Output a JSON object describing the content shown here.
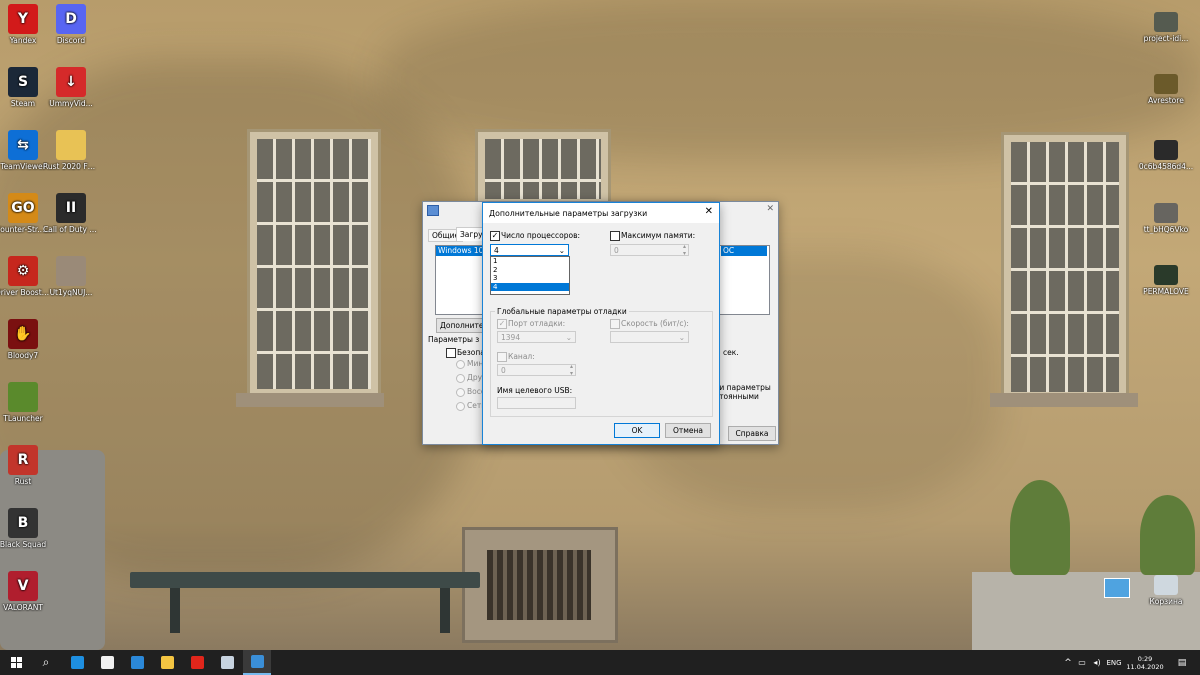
{
  "desktop": {
    "icons_left": [
      {
        "label": "Yandex",
        "color": "#d21a1a",
        "glyph": "Y"
      },
      {
        "label": "Discord",
        "color": "#5865f2",
        "glyph": "D"
      },
      {
        "label": "Steam",
        "color": "#1b2838",
        "glyph": "S"
      },
      {
        "label": "UmmyVid...",
        "color": "#d52a2a",
        "glyph": "↓"
      },
      {
        "label": "TeamViewer",
        "color": "#0e6fd6",
        "glyph": "⇆"
      },
      {
        "label": "Rust 2020 FPS Pack",
        "color": "#e8c255",
        "glyph": ""
      },
      {
        "label": "Counter-Str... Global Offe...",
        "color": "#d48a18",
        "glyph": "GO"
      },
      {
        "label": "Call of Duty Black Ops II...",
        "color": "#2b2b2b",
        "glyph": "II"
      },
      {
        "label": "Driver Booster f...",
        "color": "#c6271d",
        "glyph": "⚙"
      },
      {
        "label": "Ut1yqNUJ...",
        "color": "#9a8a78",
        "glyph": ""
      },
      {
        "label": "Bloody7",
        "color": "#7a1010",
        "glyph": "✋"
      },
      {
        "label": "TLauncher",
        "color": "#5a8a2c",
        "glyph": ""
      },
      {
        "label": "Rust",
        "color": "#c2352b",
        "glyph": "R"
      },
      {
        "label": "Black Squad",
        "color": "#333333",
        "glyph": "B"
      },
      {
        "label": "VALORANT",
        "color": "#b01e2e",
        "glyph": "V"
      }
    ],
    "icons_right": [
      {
        "label": "project-idi...",
        "color": "#555b50"
      },
      {
        "label": "Avrestore",
        "color": "#6b5a2a"
      },
      {
        "label": "0c6b4586d4...",
        "color": "#2a2a2a"
      },
      {
        "label": "tt_bHQ6Vko",
        "color": "#676560"
      },
      {
        "label": "PERMALOVE",
        "color": "#2a3a2a"
      },
      {
        "label": "Корзина",
        "color": "#cfd8df"
      }
    ]
  },
  "back_dialog": {
    "tabs": [
      "Общие",
      "Загруз"
    ],
    "list_item_left": "Windows 10 (C",
    "list_item_right": "OC",
    "advanced_button": "Дополнительн",
    "group_label": "Параметры з",
    "safe_boot": "Безопасн",
    "radios": [
      "Мини",
      "Друг",
      "Восст",
      "Сеть"
    ],
    "right_text_1": "сек.",
    "right_text_2": "ти параметры",
    "right_text_3": "стоянными",
    "help_button": "Справка",
    "close_symbol": "✕"
  },
  "front_dialog": {
    "title": "Дополнительные параметры загрузки",
    "close_symbol": "✕",
    "num_processors_label": "Число процессоров:",
    "num_processors_checked": true,
    "num_processors_value": "4",
    "dropdown_options": [
      "1",
      "2",
      "3",
      "4"
    ],
    "dropdown_selected_index": 3,
    "max_memory_label": "Максимум памяти:",
    "max_memory_checked": false,
    "max_memory_value": "0",
    "debug_group_title": "Глобальные параметры отладки",
    "debug_port_label": "Порт отладки:",
    "debug_port_value": "1394",
    "speed_label": "Скорость (бит/с):",
    "speed_value": "",
    "channel_label": "Канал:",
    "channel_value": "0",
    "usb_target_label": "Имя целевого USB:",
    "usb_target_value": "",
    "ok_button": "OK",
    "cancel_button": "Отмена"
  },
  "taskbar": {
    "start_icon": "windows-logo",
    "search_icon": "search",
    "pinned": [
      {
        "name": "edge",
        "color": "#1e8fe0"
      },
      {
        "name": "store",
        "color": "#f0f0f0"
      },
      {
        "name": "mail",
        "color": "#2b88d8"
      },
      {
        "name": "explorer",
        "color": "#f4c542"
      },
      {
        "name": "yandex",
        "color": "#e0261b"
      },
      {
        "name": "steam",
        "color": "#c8d4e0"
      },
      {
        "name": "system-config",
        "color": "#3a8fd8"
      }
    ],
    "tray_chevron": "^",
    "language": "ENG",
    "time": "0:29",
    "date": "11.04.2020"
  }
}
